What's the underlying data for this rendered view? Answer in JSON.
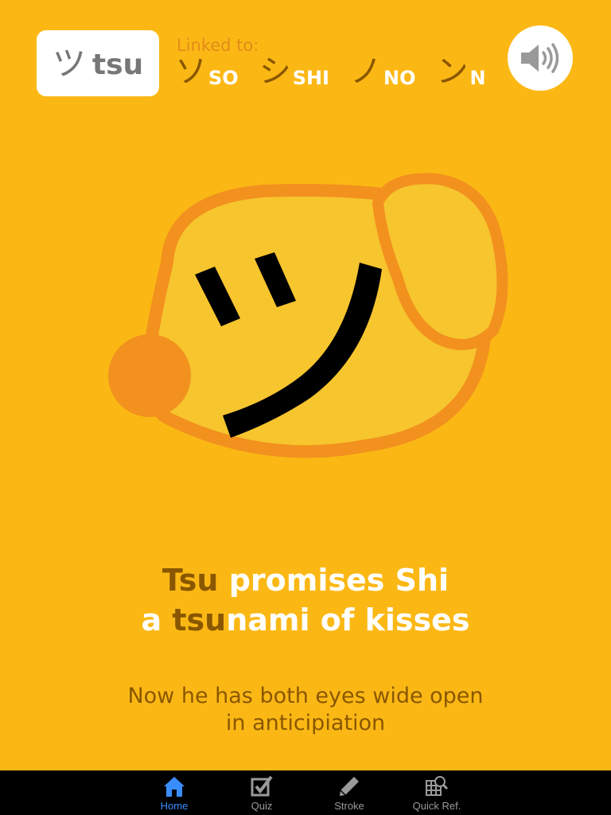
{
  "current": {
    "kana": "ツ",
    "romaji": "tsu"
  },
  "linked": {
    "label": "Linked to:",
    "items": [
      {
        "kana": "ソ",
        "romaji": "SO"
      },
      {
        "kana": "シ",
        "romaji": "SHI"
      },
      {
        "kana": "ノ",
        "romaji": "NO"
      },
      {
        "kana": "ン",
        "romaji": "N"
      }
    ]
  },
  "illustration": {
    "character": "ツ"
  },
  "mnemonic": {
    "line1_highlight": "Tsu",
    "line1_rest": " promises Shi",
    "line2_pre": "a ",
    "line2_highlight": "tsu",
    "line2_rest": "nami of kisses"
  },
  "explanation": {
    "line1": "Now he has both eyes wide open",
    "line2": "in anticipiation"
  },
  "tabs": [
    {
      "label": "Home",
      "icon": "home-icon",
      "active": true
    },
    {
      "label": "Quiz",
      "icon": "checkbox-icon",
      "active": false
    },
    {
      "label": "Stroke",
      "icon": "pencil-icon",
      "active": false
    },
    {
      "label": "Quick Ref.",
      "icon": "grid-search-icon",
      "active": false
    }
  ],
  "colors": {
    "background": "#FBB815",
    "accent_brown": "#8A5700",
    "linked_label": "#E38B1A",
    "tab_active": "#3A8DFF",
    "mascot_fill": "#F7C52E",
    "mascot_outline": "#F2911E"
  }
}
